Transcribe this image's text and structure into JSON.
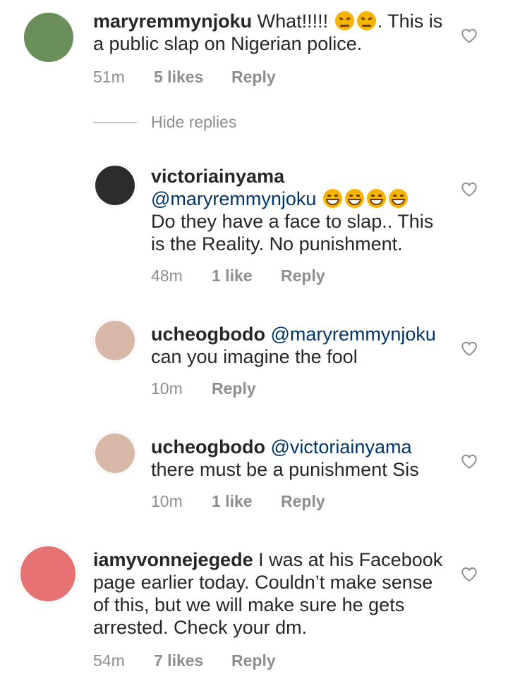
{
  "comments": [
    {
      "username": "maryremmynjoku",
      "mention": "",
      "text_before": "What!!!!!",
      "text_after": ". This is a public slap on Nigerian police.",
      "time": "51m",
      "likes": "5 likes",
      "reply": "Reply",
      "emojis": [
        "angry-face-emoji",
        "angry-face-emoji"
      ]
    },
    {
      "username": "victoriainyama",
      "mention": "@maryremmynjoku",
      "text": "Do they have a face to slap.. This is the Reality. No punishment.",
      "time": "48m",
      "likes": "1 like",
      "reply": "Reply",
      "emojis": [
        "grinning-face-emoji",
        "grinning-face-emoji",
        "grinning-face-emoji",
        "grinning-face-emoji"
      ]
    },
    {
      "username": "ucheogbodo",
      "mention": "@maryremmynjoku",
      "text": "can you imagine the fool",
      "time": "10m",
      "likes": "",
      "reply": "Reply"
    },
    {
      "username": "ucheogbodo",
      "mention": "@victoriainyama",
      "text": "there must be a punishment Sis",
      "time": "10m",
      "likes": "1 like",
      "reply": "Reply"
    },
    {
      "username": "iamyvonnejegede",
      "mention": "",
      "text_line1": "I was at his Facebook",
      "text_line2": "page earlier today. Couldn’t make sense",
      "text_line3": "of this, but we will make sure he gets",
      "text_line4": "arrested. Check your dm.",
      "time": "54m",
      "likes": "7 likes",
      "reply": "Reply"
    }
  ],
  "hide_replies": "Hide replies",
  "icons": {
    "like": "heart-outline-icon"
  },
  "colors": {
    "mention": "#003569",
    "meta": "#8e8e8e",
    "text": "#262626"
  }
}
